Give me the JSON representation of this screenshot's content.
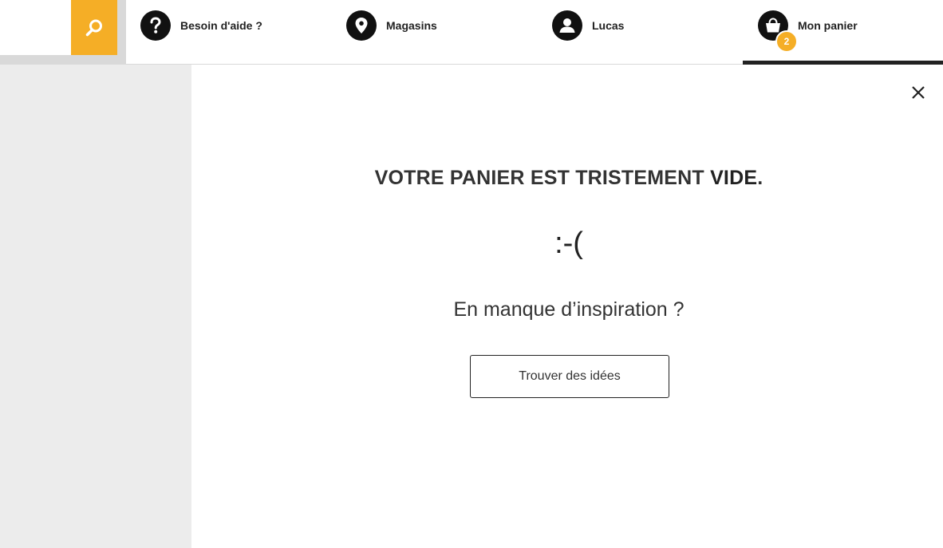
{
  "header": {
    "search": {
      "icon": "search-icon",
      "color": "#f5ae26"
    },
    "nav": {
      "help": {
        "label": "Besoin d'aide ?",
        "icon": "question-icon"
      },
      "stores": {
        "label": "Magasins",
        "icon": "location-pin-icon"
      },
      "account": {
        "label": "Lucas",
        "icon": "user-icon"
      },
      "cart": {
        "label": "Mon panier",
        "icon": "shopping-bag-icon",
        "count": "2"
      }
    }
  },
  "cart_panel": {
    "close_icon": "close-icon",
    "title_prefix": "VOTRE PANIER EST TRISTEMENT ",
    "title_emphasis": "VIDE",
    "title_suffix": ".",
    "emoticon": ":-(",
    "subtitle": "En manque d’inspiration ?",
    "cta_label": "Trouver des idées"
  },
  "colors": {
    "accent": "#f5ae26",
    "dark": "#222222",
    "sidebar_bg": "#ececec"
  }
}
